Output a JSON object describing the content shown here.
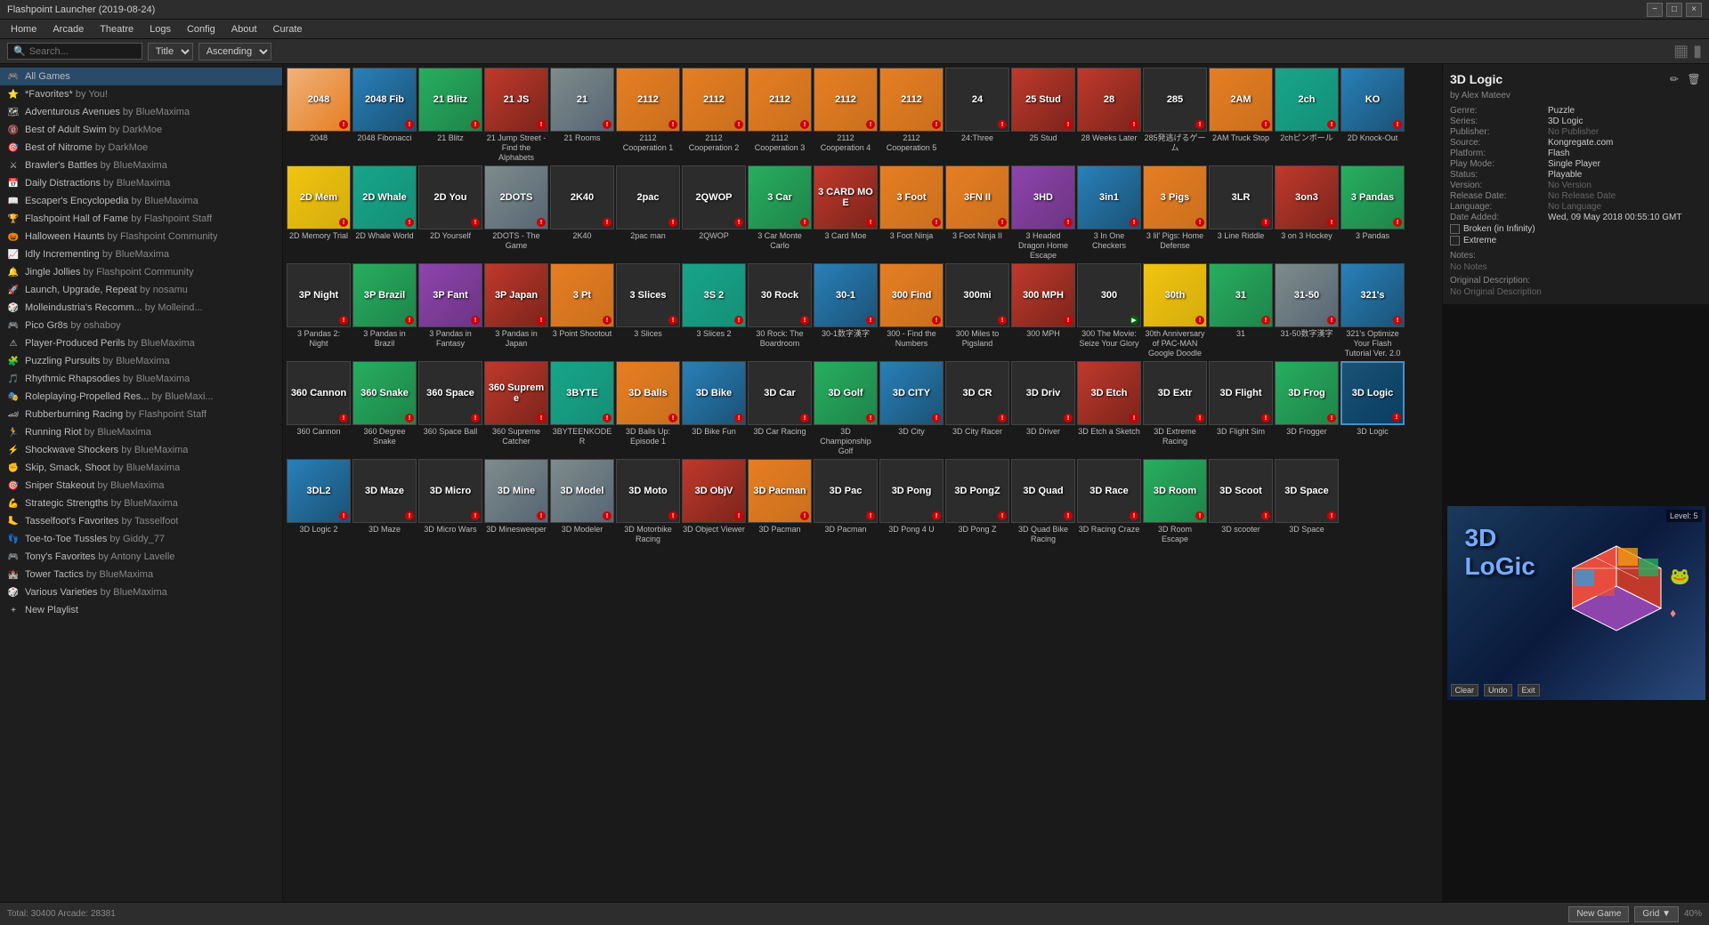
{
  "titlebar": {
    "title": "Flashpoint Launcher (2019-08-24)",
    "min_label": "−",
    "max_label": "□",
    "close_label": "×"
  },
  "menubar": {
    "items": [
      "Home",
      "Arcade",
      "Theatre",
      "Logs",
      "Config",
      "About",
      "Curate"
    ]
  },
  "toolbar": {
    "search_placeholder": "Search...",
    "sort_field": "Title",
    "sort_order": "Ascending"
  },
  "sidebar": {
    "items": [
      {
        "icon": "🎮",
        "label": "All Games",
        "by": "",
        "active": true
      },
      {
        "icon": "⭐",
        "label": "*Favorites*",
        "by": " by You!"
      },
      {
        "icon": "🗺",
        "label": "Adventurous Avenues",
        "by": " by BlueMaxima"
      },
      {
        "icon": "🔞",
        "label": "Best of Adult Swim",
        "by": " by DarkMoe"
      },
      {
        "icon": "🎯",
        "label": "Best of Nitrome",
        "by": " by DarkMoe"
      },
      {
        "icon": "⚔",
        "label": "Brawler's Battles",
        "by": " by BlueMaxima"
      },
      {
        "icon": "📅",
        "label": "Daily Distractions",
        "by": " by BlueMaxima"
      },
      {
        "icon": "📖",
        "label": "Escaper's Encyclopedia",
        "by": " by BlueMaxima"
      },
      {
        "icon": "🏆",
        "label": "Flashpoint Hall of Fame",
        "by": " by Flashpoint Staff"
      },
      {
        "icon": "🎃",
        "label": "Halloween Haunts",
        "by": " by Flashpoint Community"
      },
      {
        "icon": "📈",
        "label": "Idly Incrementing",
        "by": " by BlueMaxima"
      },
      {
        "icon": "🔔",
        "label": "Jingle Jollies",
        "by": " by Flashpoint Community"
      },
      {
        "icon": "🚀",
        "label": "Launch, Upgrade, Repeat",
        "by": " by nosamu"
      },
      {
        "icon": "🎲",
        "label": "Molleindustria's Recomm...",
        "by": " by Molleind..."
      },
      {
        "icon": "🎮",
        "label": "Pico Gr8s",
        "by": " by oshaboy"
      },
      {
        "icon": "⚠",
        "label": "Player-Produced Perils",
        "by": " by BlueMaxima"
      },
      {
        "icon": "🧩",
        "label": "Puzzling Pursuits",
        "by": " by BlueMaxima"
      },
      {
        "icon": "🎵",
        "label": "Rhythmic Rhapsodies",
        "by": " by BlueMaxima"
      },
      {
        "icon": "🎭",
        "label": "Roleplaying-Propelled Res...",
        "by": " by BlueMaxi..."
      },
      {
        "icon": "🏎",
        "label": "Rubberburning Racing",
        "by": " by Flashpoint Staff"
      },
      {
        "icon": "🏃",
        "label": "Running Riot",
        "by": " by BlueMaxima"
      },
      {
        "icon": "⚡",
        "label": "Shockwave Shockers",
        "by": " by BlueMaxima"
      },
      {
        "icon": "✊",
        "label": "Skip, Smack, Shoot",
        "by": " by BlueMaxima"
      },
      {
        "icon": "🎯",
        "label": "Sniper Stakeout",
        "by": " by BlueMaxima"
      },
      {
        "icon": "💪",
        "label": "Strategic Strengths",
        "by": " by BlueMaxima"
      },
      {
        "icon": "🦶",
        "label": "Tasselfoot's Favorites",
        "by": " by Tasselfoot"
      },
      {
        "icon": "👣",
        "label": "Toe-to-Toe Tussles",
        "by": " by Giddy_77"
      },
      {
        "icon": "🎮",
        "label": "Tony's Favorites",
        "by": " by Antony Lavelle"
      },
      {
        "icon": "🏰",
        "label": "Tower Tactics",
        "by": " by BlueMaxima"
      },
      {
        "icon": "🎲",
        "label": "Various Varieties",
        "by": " by BlueMaxima"
      },
      {
        "icon": "+",
        "label": "New Playlist",
        "by": ""
      }
    ]
  },
  "games": [
    {
      "id": "2048",
      "label": "2048",
      "color": "thumb-2048",
      "text": "2048",
      "badge": "r"
    },
    {
      "id": "2048fib",
      "label": "2048 Fibonacci",
      "color": "thumb-blue",
      "text": "2048\nFib",
      "badge": "r"
    },
    {
      "id": "21blitz",
      "label": "21 Blitz",
      "color": "thumb-green",
      "text": "21\nBlitz",
      "badge": "r"
    },
    {
      "id": "21jump",
      "label": "21 Jump Street - Find the Alphabets",
      "color": "thumb-red",
      "text": "21 JS",
      "badge": "r"
    },
    {
      "id": "21rooms",
      "label": "21 Rooms",
      "color": "thumb-gray",
      "text": "21",
      "badge": "r"
    },
    {
      "id": "2112coop1",
      "label": "2112 Cooperation 1",
      "color": "thumb-orange",
      "text": "2112",
      "badge": "r"
    },
    {
      "id": "2112coop2",
      "label": "2112 Cooperation 2",
      "color": "thumb-orange",
      "text": "2112",
      "badge": "r"
    },
    {
      "id": "2112coop3",
      "label": "2112 Cooperation 3",
      "color": "thumb-orange",
      "text": "2112",
      "badge": "r"
    },
    {
      "id": "2112coop4",
      "label": "2112 Cooperation 4",
      "color": "thumb-orange",
      "text": "2112",
      "badge": "r"
    },
    {
      "id": "2112coop5",
      "label": "2112 Cooperation 5",
      "color": "thumb-orange",
      "text": "2112",
      "badge": "r"
    },
    {
      "id": "24three",
      "label": "24:Three",
      "color": "thumb-dark",
      "text": "24",
      "badge": "r"
    },
    {
      "id": "25stud",
      "label": "25 Stud",
      "color": "thumb-red",
      "text": "25\nStud",
      "badge": "r"
    },
    {
      "id": "28weeks",
      "label": "28 Weeks Later",
      "color": "thumb-red",
      "text": "28",
      "badge": "r"
    },
    {
      "id": "285game",
      "label": "285発逃げるゲーム",
      "color": "thumb-dark",
      "text": "285",
      "badge": "r"
    },
    {
      "id": "2am",
      "label": "2AM Truck Stop",
      "color": "thumb-orange",
      "text": "2AM",
      "badge": "r"
    },
    {
      "id": "2ch",
      "label": "2chピンボール",
      "color": "thumb-cyan",
      "text": "2ch",
      "badge": "r"
    },
    {
      "id": "2dknockout",
      "label": "2D Knock-Out",
      "color": "thumb-blue",
      "text": "KO",
      "badge": "r"
    },
    {
      "id": "2dmemory",
      "label": "2D Memory Trial",
      "color": "thumb-yellow",
      "text": "2D\nMem",
      "badge": "r"
    },
    {
      "id": "2dwhale",
      "label": "2D Whale World",
      "color": "thumb-cyan",
      "text": "2D\nWhale",
      "badge": "r"
    },
    {
      "id": "2dyourself",
      "label": "2D Yourself",
      "color": "thumb-dark",
      "text": "2D\nYou",
      "badge": "r"
    },
    {
      "id": "2dots",
      "label": "2DOTS - The Game",
      "color": "thumb-gray",
      "text": "2DOTS",
      "badge": "r"
    },
    {
      "id": "2k40",
      "label": "2K40",
      "color": "thumb-dark",
      "text": "2K40",
      "badge": "r"
    },
    {
      "id": "2pacman",
      "label": "2pac man",
      "color": "thumb-dark",
      "text": "2pac",
      "badge": "r"
    },
    {
      "id": "2qwop",
      "label": "2QWOP",
      "color": "thumb-dark",
      "text": "2QWOP",
      "badge": "r"
    },
    {
      "id": "3carMC",
      "label": "3 Car Monte Carlo",
      "color": "thumb-green",
      "text": "3 Car",
      "badge": "r"
    },
    {
      "id": "3cardmoe",
      "label": "3 Card Moe",
      "color": "thumb-red",
      "text": "3 CARD\nMOE",
      "badge": "r"
    },
    {
      "id": "3footninja",
      "label": "3 Foot Ninja",
      "color": "thumb-orange",
      "text": "3 Foot",
      "badge": "r"
    },
    {
      "id": "3footninja2",
      "label": "3 Foot Ninja II",
      "color": "thumb-orange",
      "text": "3FN II",
      "badge": "r"
    },
    {
      "id": "3headeddrag",
      "label": "3 Headed Dragon Home Escape",
      "color": "thumb-purple",
      "text": "3HD",
      "badge": "r"
    },
    {
      "id": "3inone",
      "label": "3 In One Checkers",
      "color": "thumb-blue",
      "text": "3in1",
      "badge": "r"
    },
    {
      "id": "3lilpigs",
      "label": "3 lil' Pigs: Home Defense",
      "color": "thumb-orange",
      "text": "3 Pigs",
      "badge": "r"
    },
    {
      "id": "3lineriddle",
      "label": "3 Line Riddle",
      "color": "thumb-dark",
      "text": "3LR",
      "badge": "r"
    },
    {
      "id": "3on3hockey",
      "label": "3 on 3 Hockey",
      "color": "thumb-red",
      "text": "3on3",
      "badge": "r"
    },
    {
      "id": "3pandas",
      "label": "3 Pandas",
      "color": "thumb-green",
      "text": "3\nPandas",
      "badge": "r"
    },
    {
      "id": "3pandasnight",
      "label": "3 Pandas 2: Night",
      "color": "thumb-dark",
      "text": "3P Night",
      "badge": "r"
    },
    {
      "id": "3pandabrazil",
      "label": "3 Pandas in Brazil",
      "color": "thumb-green",
      "text": "3P\nBrazil",
      "badge": "r"
    },
    {
      "id": "3pandafantasy",
      "label": "3 Pandas in Fantasy",
      "color": "thumb-purple",
      "text": "3P\nFant",
      "badge": "r"
    },
    {
      "id": "3pandajapan",
      "label": "3 Pandas in Japan",
      "color": "thumb-red",
      "text": "3P\nJapan",
      "badge": "r"
    },
    {
      "id": "3pointshoot",
      "label": "3 Point Shootout",
      "color": "thumb-orange",
      "text": "3 Pt",
      "badge": "r"
    },
    {
      "id": "3slices",
      "label": "3 Slices",
      "color": "thumb-dark",
      "text": "3\nSlices",
      "badge": "r"
    },
    {
      "id": "3slices2",
      "label": "3 Slices 2",
      "color": "thumb-cyan",
      "text": "3S 2",
      "badge": "r"
    },
    {
      "id": "30rock",
      "label": "30 Rock: The Boardroom",
      "color": "thumb-dark",
      "text": "30\nRock",
      "badge": "r"
    },
    {
      "id": "30kanji",
      "label": "30-1数字漢字",
      "color": "thumb-blue",
      "text": "30-1",
      "badge": "r"
    },
    {
      "id": "300find",
      "label": "300 - Find the Numbers",
      "color": "thumb-orange",
      "text": "300\nFind",
      "badge": "r"
    },
    {
      "id": "300miles",
      "label": "300 Miles to Pigsland",
      "color": "thumb-dark",
      "text": "300mi",
      "badge": "r"
    },
    {
      "id": "300mph",
      "label": "300 MPH",
      "color": "thumb-red",
      "text": "300\nMPH",
      "badge": "r"
    },
    {
      "id": "300movie",
      "label": "300 The Movie: Seize Your Glory",
      "color": "thumb-dark",
      "text": "300",
      "badge": "v"
    },
    {
      "id": "30thgoogle",
      "label": "30th Anniversary of PAC-MAN Google Doodle",
      "color": "thumb-yellow",
      "text": "30th",
      "badge": "r"
    },
    {
      "id": "31",
      "label": "31",
      "color": "thumb-green",
      "text": "31",
      "badge": "r"
    },
    {
      "id": "3150kanji",
      "label": "31-50数字漢字",
      "color": "thumb-gray",
      "text": "31-50",
      "badge": "r"
    },
    {
      "id": "321optimize",
      "label": "321's Optimize Your Flash Tutorial Ver. 2.0",
      "color": "thumb-blue",
      "text": "321's",
      "badge": "r"
    },
    {
      "id": "360cannon",
      "label": "360 Cannon",
      "color": "thumb-dark",
      "text": "360\nCannon",
      "badge": "r"
    },
    {
      "id": "360snake",
      "label": "360 Degree Snake",
      "color": "thumb-green",
      "text": "360\nSnake",
      "badge": "r"
    },
    {
      "id": "360space",
      "label": "360 Space Ball",
      "color": "thumb-dark",
      "text": "360\nSpace",
      "badge": "r"
    },
    {
      "id": "360supreme",
      "label": "360 Supreme Catcher",
      "color": "thumb-red",
      "text": "360\nSupreme",
      "badge": "r"
    },
    {
      "id": "3byteen",
      "label": "3BYTEENKODER",
      "color": "thumb-cyan",
      "text": "3BYTE",
      "badge": "r"
    },
    {
      "id": "3dballs",
      "label": "3D Balls Up: Episode 1",
      "color": "thumb-orange",
      "text": "3D\nBalls",
      "badge": "r"
    },
    {
      "id": "3dbike",
      "label": "3D Bike Fun",
      "color": "thumb-blue",
      "text": "3D\nBike",
      "badge": "r"
    },
    {
      "id": "3dcar",
      "label": "3D Car Racing",
      "color": "thumb-dark",
      "text": "3D\nCar",
      "badge": "r"
    },
    {
      "id": "3dchamp",
      "label": "3D Championship Golf",
      "color": "thumb-green",
      "text": "3D\nGolf",
      "badge": "r"
    },
    {
      "id": "3dcity",
      "label": "3D City",
      "color": "thumb-blue",
      "text": "3D\nCITY",
      "badge": "r"
    },
    {
      "id": "3dcityracer",
      "label": "3D City Racer",
      "color": "thumb-dark",
      "text": "3D CR",
      "badge": "r"
    },
    {
      "id": "3ddriver",
      "label": "3D Driver",
      "color": "thumb-dark",
      "text": "3D\nDriv",
      "badge": "r"
    },
    {
      "id": "3detch",
      "label": "3D Etch a Sketch",
      "color": "thumb-red",
      "text": "3D\nEtch",
      "badge": "r"
    },
    {
      "id": "3dextreme",
      "label": "3D Extreme Racing",
      "color": "thumb-dark",
      "text": "3D\nExtr",
      "badge": "r"
    },
    {
      "id": "3dflight",
      "label": "3D Flight Sim",
      "color": "thumb-dark",
      "text": "3D\nFlight",
      "badge": "r"
    },
    {
      "id": "3dfrogger",
      "label": "3D Frogger",
      "color": "thumb-green",
      "text": "3D\nFrog",
      "badge": "r"
    },
    {
      "id": "3dlogic",
      "label": "3D Logic",
      "color": "thumb-3dlogic",
      "text": "3D\nLogic",
      "badge": "r",
      "selected": true
    },
    {
      "id": "3dlogic2",
      "label": "3D Logic 2",
      "color": "thumb-blue",
      "text": "3DL2",
      "badge": "r"
    },
    {
      "id": "3dmaze",
      "label": "3D Maze",
      "color": "thumb-dark",
      "text": "3D\nMaze",
      "badge": "r"
    },
    {
      "id": "3dmicro",
      "label": "3D Micro Wars",
      "color": "thumb-dark",
      "text": "3D\nMicro",
      "badge": "r"
    },
    {
      "id": "3dmine",
      "label": "3D Minesweeper",
      "color": "thumb-gray",
      "text": "3D\nMine",
      "badge": "r"
    },
    {
      "id": "3dmodeler",
      "label": "3D Modeler",
      "color": "thumb-gray",
      "text": "3D\nModel",
      "badge": "r"
    },
    {
      "id": "3dmotorbike",
      "label": "3D Motorbike Racing",
      "color": "thumb-dark",
      "text": "3D\nMoto",
      "badge": "r"
    },
    {
      "id": "3dobject",
      "label": "3D Object Viewer",
      "color": "thumb-red",
      "text": "3D\nObjV",
      "badge": "r"
    },
    {
      "id": "3dpacman",
      "label": "3D Pacman",
      "color": "thumb-orange",
      "text": "3D\nPacman",
      "badge": "r"
    },
    {
      "id": "3dpacman2",
      "label": "3D Pacman",
      "color": "thumb-dark",
      "text": "3D\nPac",
      "badge": "r"
    },
    {
      "id": "3dpong4u",
      "label": "3D Pong 4 U",
      "color": "thumb-dark",
      "text": "3D\nPong",
      "badge": "r"
    },
    {
      "id": "3dpongz",
      "label": "3D Pong Z",
      "color": "thumb-dark",
      "text": "3D\nPongZ",
      "badge": "r"
    },
    {
      "id": "3dquad",
      "label": "3D Quad Bike Racing",
      "color": "thumb-dark",
      "text": "3D\nQuad",
      "badge": "r"
    },
    {
      "id": "3dracing",
      "label": "3D Racing Craze",
      "color": "thumb-dark",
      "text": "3D\nRace",
      "badge": "r"
    },
    {
      "id": "3droom",
      "label": "3D Room Escape",
      "color": "thumb-green",
      "text": "3D\nRoom",
      "badge": "r"
    },
    {
      "id": "3dscooter",
      "label": "3D scooter",
      "color": "thumb-dark",
      "text": "3D\nScoot",
      "badge": "r"
    },
    {
      "id": "3dspace",
      "label": "3D Space",
      "color": "thumb-dark",
      "text": "3D\nSpace",
      "badge": "r"
    }
  ],
  "selected_game": {
    "title": "3D Logic",
    "author": "by Alex Mateev",
    "genre": "Puzzle",
    "series": "3D Logic",
    "publisher": "No Publisher",
    "source": "Kongregate.com",
    "platform": "Flash",
    "play_mode": "Single Player",
    "status": "Playable",
    "version": "No Version",
    "release_date": "No Release Date",
    "language": "No Language",
    "date_added": "Wed, 09 May 2018 00:55:10 GMT",
    "broken": false,
    "extreme": false,
    "notes": "No Notes",
    "orig_desc": "No Original Description",
    "level": "Level: 5"
  },
  "bottom": {
    "total": "Total: 30400  Arcade: 28381",
    "new_game": "New Game",
    "grid": "Grid ▼",
    "zoom": "40%"
  }
}
